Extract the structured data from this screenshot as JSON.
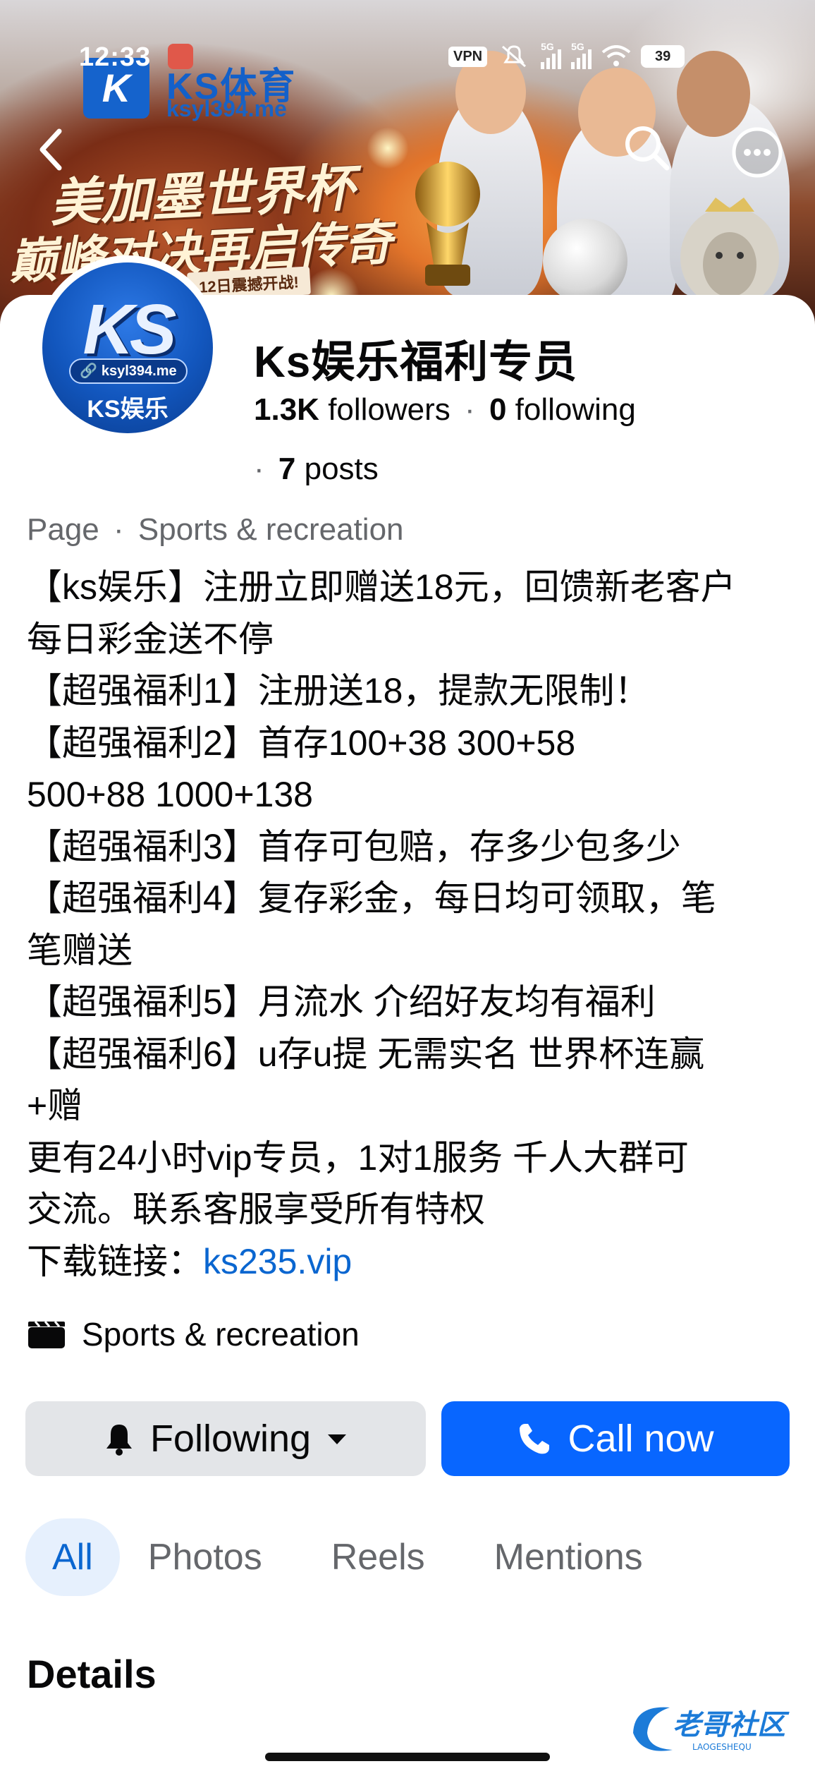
{
  "status_bar": {
    "time": "12:33",
    "vpn": "VPN",
    "signal_1": "5G",
    "signal_2": "5G",
    "battery": "39"
  },
  "cover": {
    "brand_name": "KS体育",
    "brand_url": "ksyl394.me",
    "headline_1": "美加墨世界杯",
    "headline_2": "巅峰对决再启传奇",
    "date_banner": "12日震撼开战!"
  },
  "avatar": {
    "logo_text": "KS",
    "url": "ksyl394.me",
    "label": "KS娱乐"
  },
  "profile": {
    "name": "Ks娱乐福利专员",
    "followers_count": "1.3K",
    "followers_label": "followers",
    "following_count": "0",
    "following_label": "following",
    "posts_count": "7",
    "posts_label": "posts",
    "page_type": "Page",
    "category": "Sports & recreation"
  },
  "bio": {
    "lines": [
      "【ks娱乐】注册立即赠送18元，回馈新老客户",
      "每日彩金送不停",
      "【超强福利1】注册送18，提款无限制！",
      "【超强福利2】首存100+38 300+58",
      "500+88 1000+138",
      "【超强福利3】首存可包赔，存多少包多少",
      "【超强福利4】复存彩金，每日均可领取，笔",
      "笔赠送",
      "【超强福利5】月流水 介绍好友均有福利",
      "【超强福利6】u存u提 无需实名 世界杯连赢",
      "+赠",
      "更有24小时vip专员，1对1服务 千人大群可",
      "交流。联系客服享受所有特权"
    ],
    "download_prefix": "下载链接：",
    "download_link": "ks235.vip"
  },
  "category_row": {
    "label": "Sports & recreation"
  },
  "actions": {
    "following_label": "Following",
    "call_label": "Call now"
  },
  "tabs": [
    "All",
    "Photos",
    "Reels",
    "Mentions"
  ],
  "active_tab": "All",
  "details": {
    "title": "Details"
  },
  "watermark": {
    "text": "老哥社区",
    "subtext": "LAOGESHEQU"
  },
  "colors": {
    "accent_blue": "#0866ff",
    "link_blue": "#0a66d0",
    "secondary_text": "#65676b",
    "button_gray": "#e3e5e8",
    "active_tab_bg": "#e6f0fd"
  }
}
